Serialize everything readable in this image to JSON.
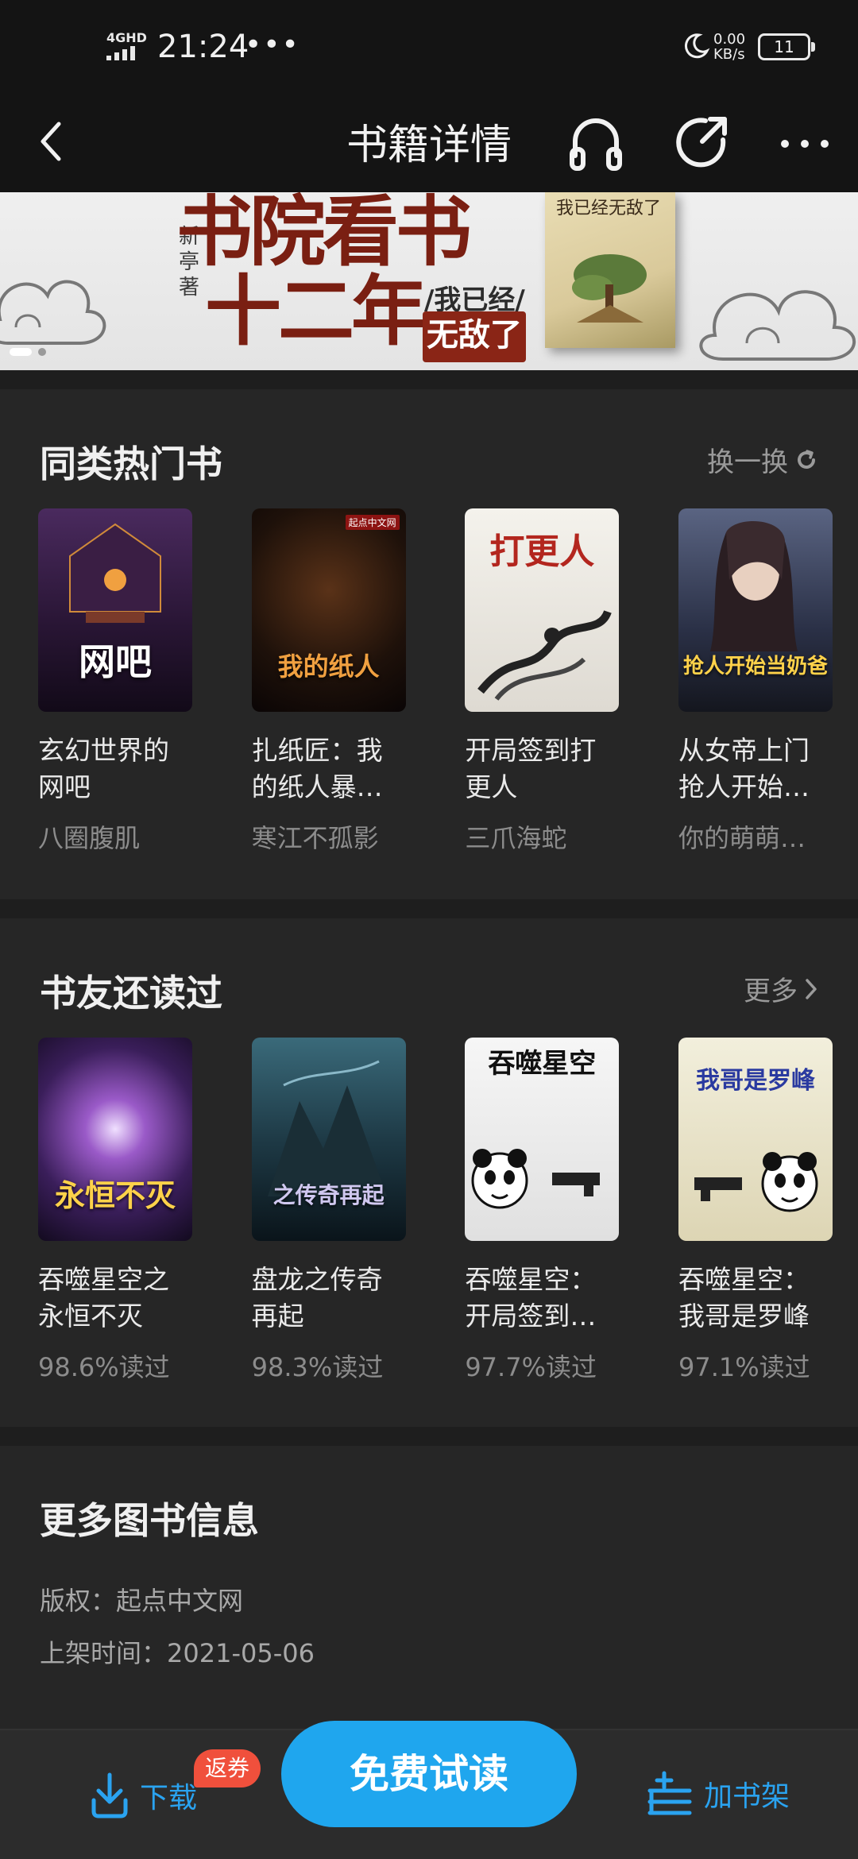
{
  "status_bar": {
    "network": "4GHD",
    "time": "21:24",
    "dots": "•••",
    "speed_value": "0.00",
    "speed_unit": "KB/s",
    "battery": "11"
  },
  "nav": {
    "title": "书籍详情"
  },
  "banner": {
    "title_line1": "书院看书",
    "title_line2": "十二年",
    "author": "新亭著",
    "subtitle1": "/我已经/",
    "subtitle2": "无敌了",
    "book_cover_text": "我已经无敌了",
    "active_index": 0,
    "total": 2
  },
  "similar": {
    "title": "同类热门书",
    "action": "换一换",
    "books": [
      {
        "name": "玄幻世界的网吧",
        "author": "八圈腹肌",
        "cover_text": "网吧",
        "cover_colors": [
          "#3a2248",
          "#1c1020"
        ]
      },
      {
        "name": "扎纸匠：我的纸人暴…",
        "author": "寒江不孤影",
        "cover_text": "我的纸人",
        "cover_colors": [
          "#2a1a12",
          "#0d0808"
        ]
      },
      {
        "name": "开局签到打更人",
        "author": "三爪海蛇",
        "cover_text": "打更人",
        "cover_colors": [
          "#f2f0ea",
          "#d8d4cc"
        ]
      },
      {
        "name": "从女帝上门抢人开始…",
        "author": "你的萌萌…",
        "cover_text": "抢人开始当奶爸",
        "cover_colors": [
          "#45506a",
          "#1a1e2c"
        ]
      }
    ]
  },
  "readers_also": {
    "title": "书友还读过",
    "action": "更多",
    "books": [
      {
        "name": "吞噬星空之永恒不灭",
        "rate": "98.6%读过",
        "cover_text": "永恒不灭",
        "cover_colors": [
          "#6a3a8c",
          "#1c1030"
        ]
      },
      {
        "name": "盘龙之传奇再起",
        "rate": "98.3%读过",
        "cover_text": "之传奇再起",
        "cover_colors": [
          "#2a4a5a",
          "#0e1a22"
        ]
      },
      {
        "name": "吞噬星空：开局签到…",
        "rate": "97.7%读过",
        "cover_text": "吞噬星空",
        "cover_colors": [
          "#f4f4f4",
          "#dcdcdc"
        ]
      },
      {
        "name": "吞噬星空：我哥是罗峰",
        "rate": "97.1%读过",
        "cover_text": "我哥是罗峰",
        "cover_colors": [
          "#f0ecd8",
          "#d8d0b0"
        ]
      }
    ]
  },
  "more_info": {
    "title": "更多图书信息",
    "copyright": "版权：起点中文网",
    "listed": "上架时间：2021-05-06"
  },
  "bottom": {
    "download": "下载",
    "coupon": "返券",
    "free_read": "免费试读",
    "add_shelf": "加书架"
  },
  "colors": {
    "accent": "#1fa6ee",
    "coupon": "#f0503c",
    "background": "#262626"
  }
}
